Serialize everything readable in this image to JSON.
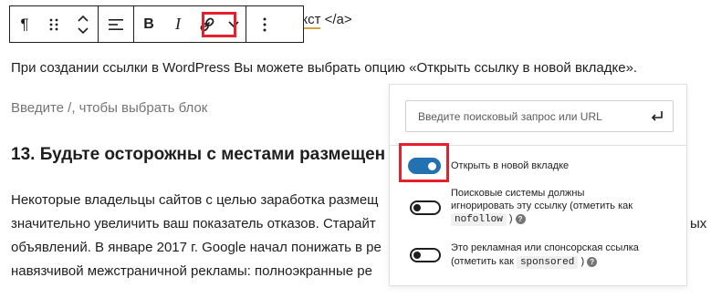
{
  "toolbar": {
    "paragraph_icon": "¶",
    "bold_label": "B",
    "italic_label": "I"
  },
  "content": {
    "link_tail_text": "екст",
    "link_tail_tag": " </a>",
    "paragraph_1": "При создании ссылки в WordPress Вы можете выбрать опцию «Открыть ссылку в новой вкладке».",
    "placeholder": "Введите /, чтобы выбрать блок",
    "heading": "13. Будьте осторожны с местами размещен",
    "body_lines": [
      "Некоторые владельцы сайтов с целью заработка размещ",
      "значительно увеличить ваш показатель отказов. Старайт",
      "объявлений. В январе 2017 г. Google начал понижать в ре",
      "навязчивой межстраничной рекламы: полноэкранные ре"
    ],
    "overflow_char": "ых"
  },
  "link_popover": {
    "search_placeholder": "Введите поисковый запрос или URL",
    "options": [
      {
        "label": "Открыть в новой вкладке",
        "enabled": true
      },
      {
        "label_line1": "Поисковые системы должны",
        "label_line2": "игнорировать эту ссылку (отметить как",
        "code": "nofollow",
        "suffix": ")",
        "enabled": false
      },
      {
        "label_line1": "Это рекламная или спонсорская ссылка",
        "label_line2": "(отметить как",
        "code": "sponsored",
        "suffix": ")",
        "enabled": false
      }
    ],
    "help_glyph": "?"
  },
  "colors": {
    "accent": "#2271b1",
    "highlight": "#e4202c",
    "link_underline": "#d6a23a"
  }
}
